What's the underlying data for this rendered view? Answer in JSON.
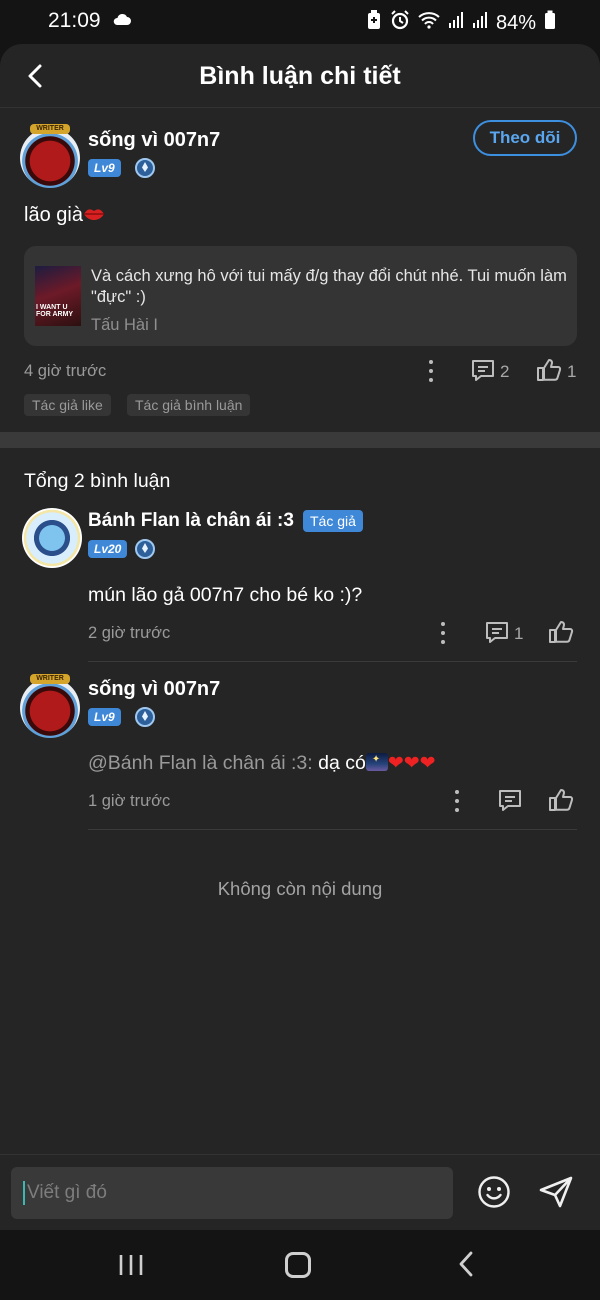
{
  "status": {
    "time": "21:09",
    "battery": "84%"
  },
  "header": {
    "title": "Bình luận chi tiết"
  },
  "post": {
    "username": "sống vì 007n7",
    "level": "Lv9",
    "avatar_badge": "WRITER",
    "follow_label": "Theo dõi",
    "text": "lão già",
    "quote": {
      "text": "Và cách xưng hô với tui mấy đ/g thay đổi chút nhé. Tui muốn làm \"đực\" :)",
      "source": "Tấu Hài I",
      "thumb_text": "I WANT U FOR ARMY"
    },
    "time": "4 giờ trước",
    "comment_count": "2",
    "like_count": "1",
    "tags": [
      "Tác giả like",
      "Tác giả bình luận"
    ]
  },
  "comments_header": "Tổng 2 bình luận",
  "comments": [
    {
      "username": "Bánh Flan là chân ái :3",
      "author_tag": "Tác giả",
      "level": "Lv20",
      "text": "mún lão gả 007n7 cho bé ko :)?",
      "time": "2 giờ trước",
      "reply_count": "1"
    },
    {
      "username": "sống vì 007n7",
      "avatar_badge": "WRITER",
      "level": "Lv9",
      "mention": "@Bánh Flan là chân ái :3:",
      "text": " dạ có",
      "hearts": "❤❤❤",
      "time": "1 giờ trước"
    }
  ],
  "end_text": "Không còn nội dung",
  "input": {
    "placeholder": "Viết gì đó"
  }
}
